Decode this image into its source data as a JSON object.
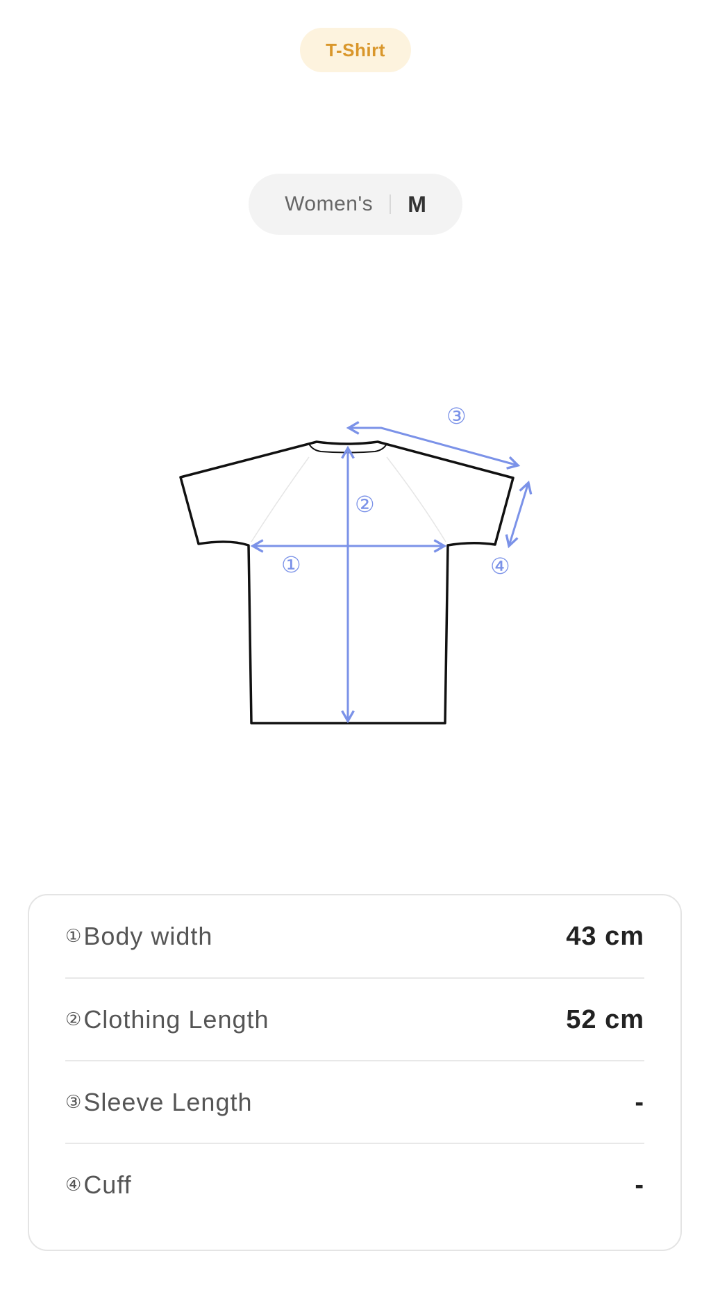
{
  "category_tag": "T-Shirt",
  "size_selector": {
    "gender": "Women's",
    "size": "M"
  },
  "diagram": {
    "markers": [
      "①",
      "②",
      "③",
      "④"
    ],
    "arrow_color": "#7b92e8"
  },
  "measurements": [
    {
      "marker": "①",
      "label": "Body width",
      "value": "43 cm"
    },
    {
      "marker": "②",
      "label": "Clothing Length",
      "value": "52 cm"
    },
    {
      "marker": "③",
      "label": "Sleeve Length",
      "value": "-"
    },
    {
      "marker": "④",
      "label": "Cuff",
      "value": "-"
    }
  ]
}
